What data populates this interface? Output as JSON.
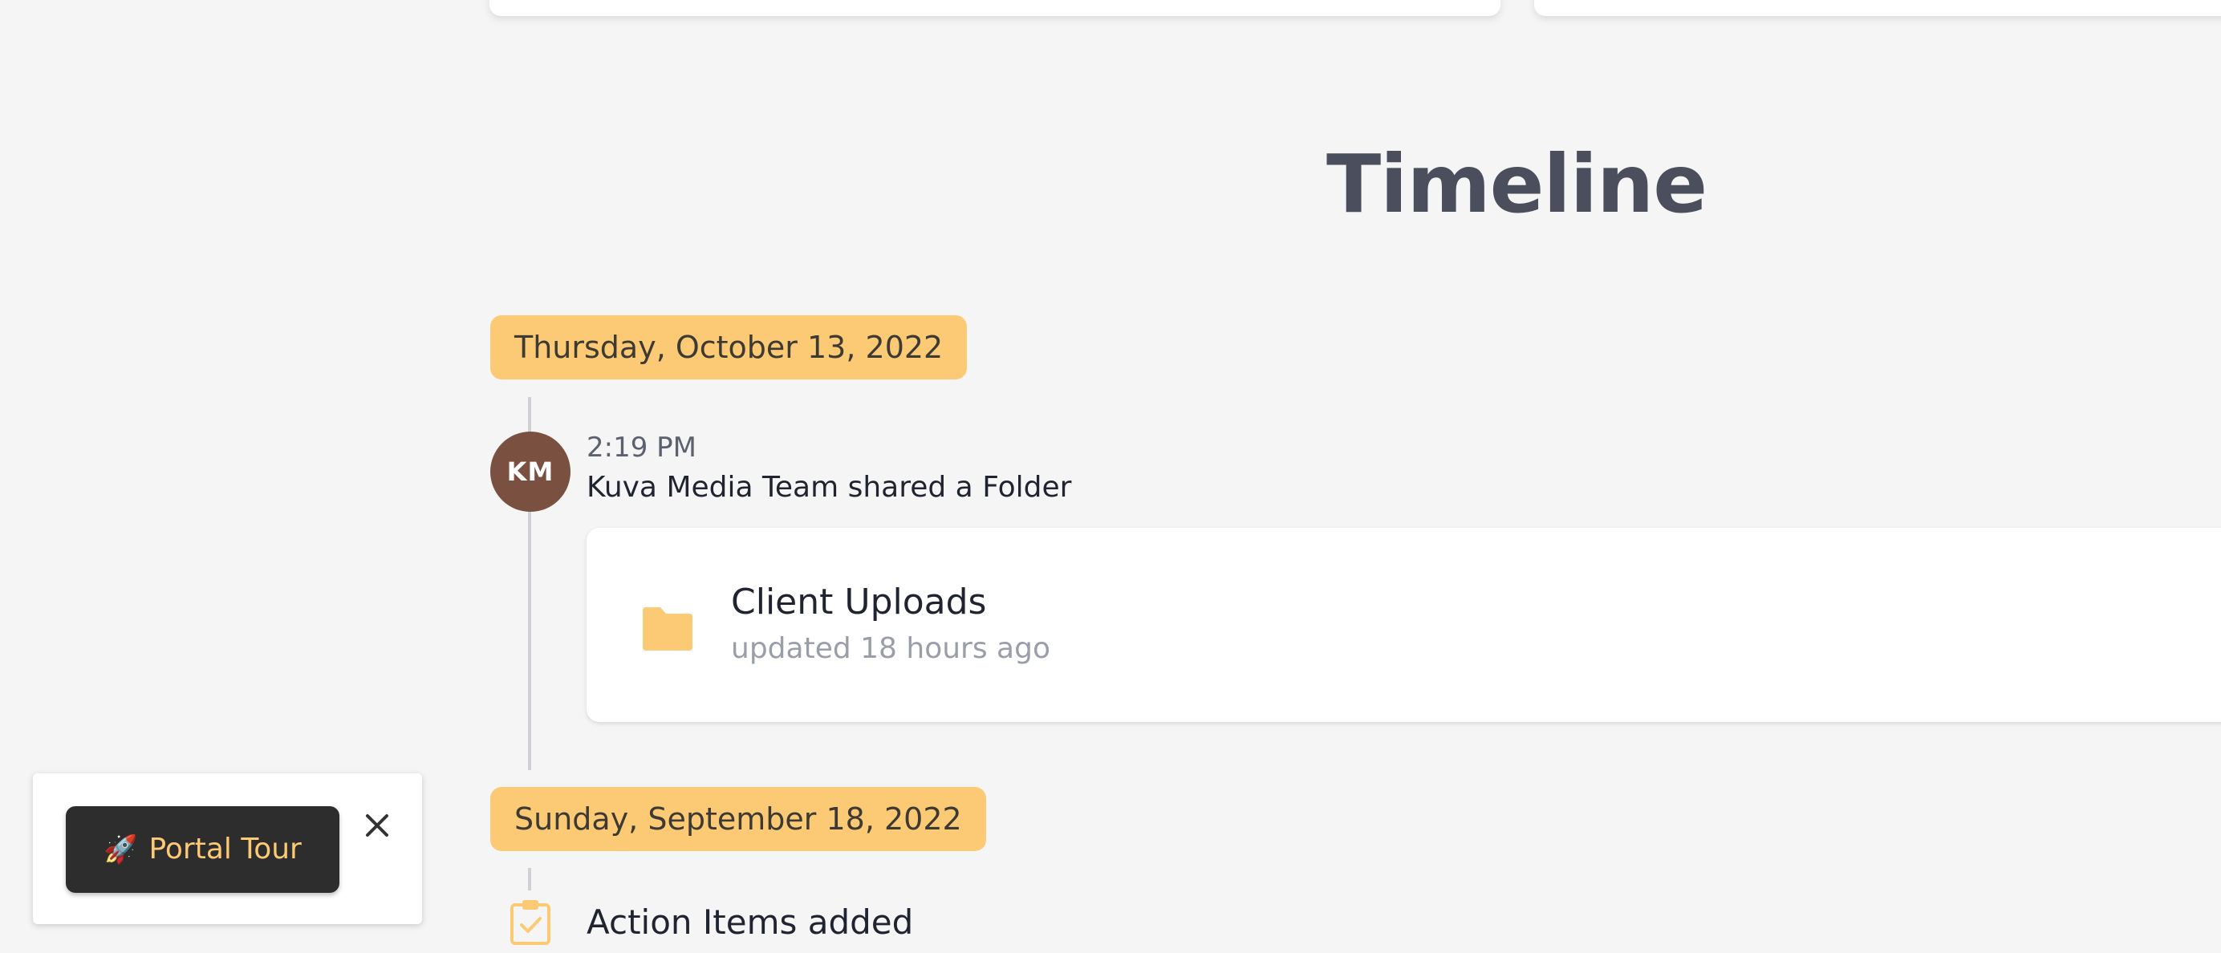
{
  "main": {
    "title": "Timeline"
  },
  "timeline": {
    "groups": [
      {
        "date": "Thursday, October 13, 2022",
        "events": [
          {
            "avatar_initials": "KM",
            "time": "2:19 PM",
            "description": "Kuva Media Team shared a Folder",
            "folder": {
              "name": "Client Uploads",
              "updated": "updated 18 hours ago",
              "icon": "folder-icon"
            }
          }
        ]
      },
      {
        "date": "Sunday, September 18, 2022",
        "events": [
          {
            "icon": "clipboard-check-icon",
            "description": "Action Items added"
          }
        ]
      }
    ]
  },
  "tour": {
    "button_label": "Portal Tour",
    "button_icon": "rocket-icon",
    "close_icon": "close-icon"
  },
  "colors": {
    "accent": "#fcca74",
    "avatar": "#7a5040",
    "title": "#4b4e5c",
    "tour_button": "#2d2d2d"
  }
}
